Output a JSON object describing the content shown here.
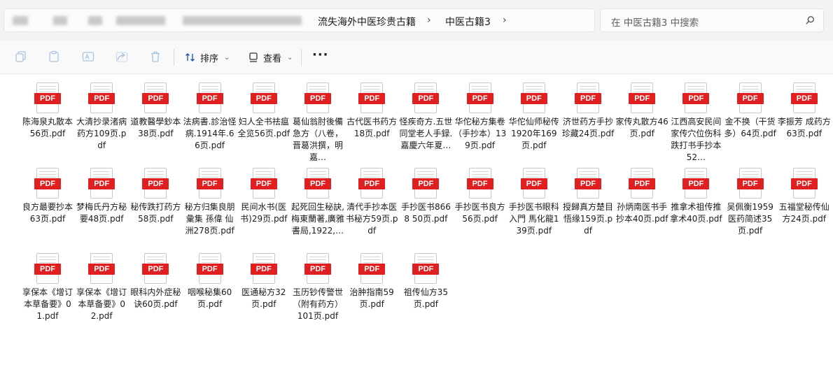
{
  "address": {
    "breadcrumbs": [
      "流失海外中医珍贵古籍",
      "中医古籍3"
    ],
    "separator": "›"
  },
  "search": {
    "placeholder": "在 中医古籍3 中搜索"
  },
  "toolbar": {
    "sort_label": "排序",
    "view_label": "查看",
    "more_label": "···"
  },
  "files": {
    "icon_label": "PDF",
    "rows": [
      [
        "陈海泉丸散本56页.pdf",
        "大清抄录渚病药方109页.pdf",
        "道教醫學鈔本38页.pdf",
        "法病書.診治怪病.1914年.66页.pdf",
        "妇人全书祛瘟全览56页.pdf",
        "葛仙翁肘後備急方（八卷，晋葛洪撰，明嘉…",
        "古代医书药方18页.pdf",
        "怪疾奇方.五世同堂老人手録.嘉慶六年夏…",
        "华佗秘方集卷（手抄本）139页.pdf",
        "华佗仙师秘传1920年169页.pdf",
        "济世药方手抄珍藏24页.pdf",
        "家传丸散方46页.pdf",
        "江西高安民间家传穴位伤科跌打书手抄本52…",
        "金不换（干货多）64页.pdf",
        "李振芳 成药方63页.pdf"
      ],
      [
        "良方最要抄本63页.pdf",
        "梦梅氏丹方秘要48页.pdf",
        "秘传跌打药方58页.pdf",
        "秘方归集良朋彙集 孫偉 仙洲278页.pdf",
        "民间水书(医书)29页.pdf",
        "起死回生秘訣,梅東蘭著,廣雅書局,1922,…",
        "清代手抄本医书秘方59页.pdf",
        "手抄医书8668 50页.pdf",
        "手抄医书良方56页.pdf",
        "手抄医书眼科入門 馬化龍139页.pdf",
        "授歸真方楚目 悟缘159页.pdf",
        "孙炳南医书手抄本40页.pdf",
        "推拿术祖传推拿术40页.pdf",
        "吴佩衡1959医药简述35页.pdf",
        "五福堂秘传仙方24页.pdf"
      ],
      [
        "享保本《增订本草备要》01.pdf",
        "享保本《增订本草备要》02.pdf",
        "眼科内外症秘诀60页.pdf",
        "咽喉秘集60页.pdf",
        "医通秘方32页.pdf",
        "玉历钞传警世（附有药方）101页.pdf",
        "治肿指南59页.pdf",
        "祖传仙方35页.pdf"
      ]
    ]
  }
}
